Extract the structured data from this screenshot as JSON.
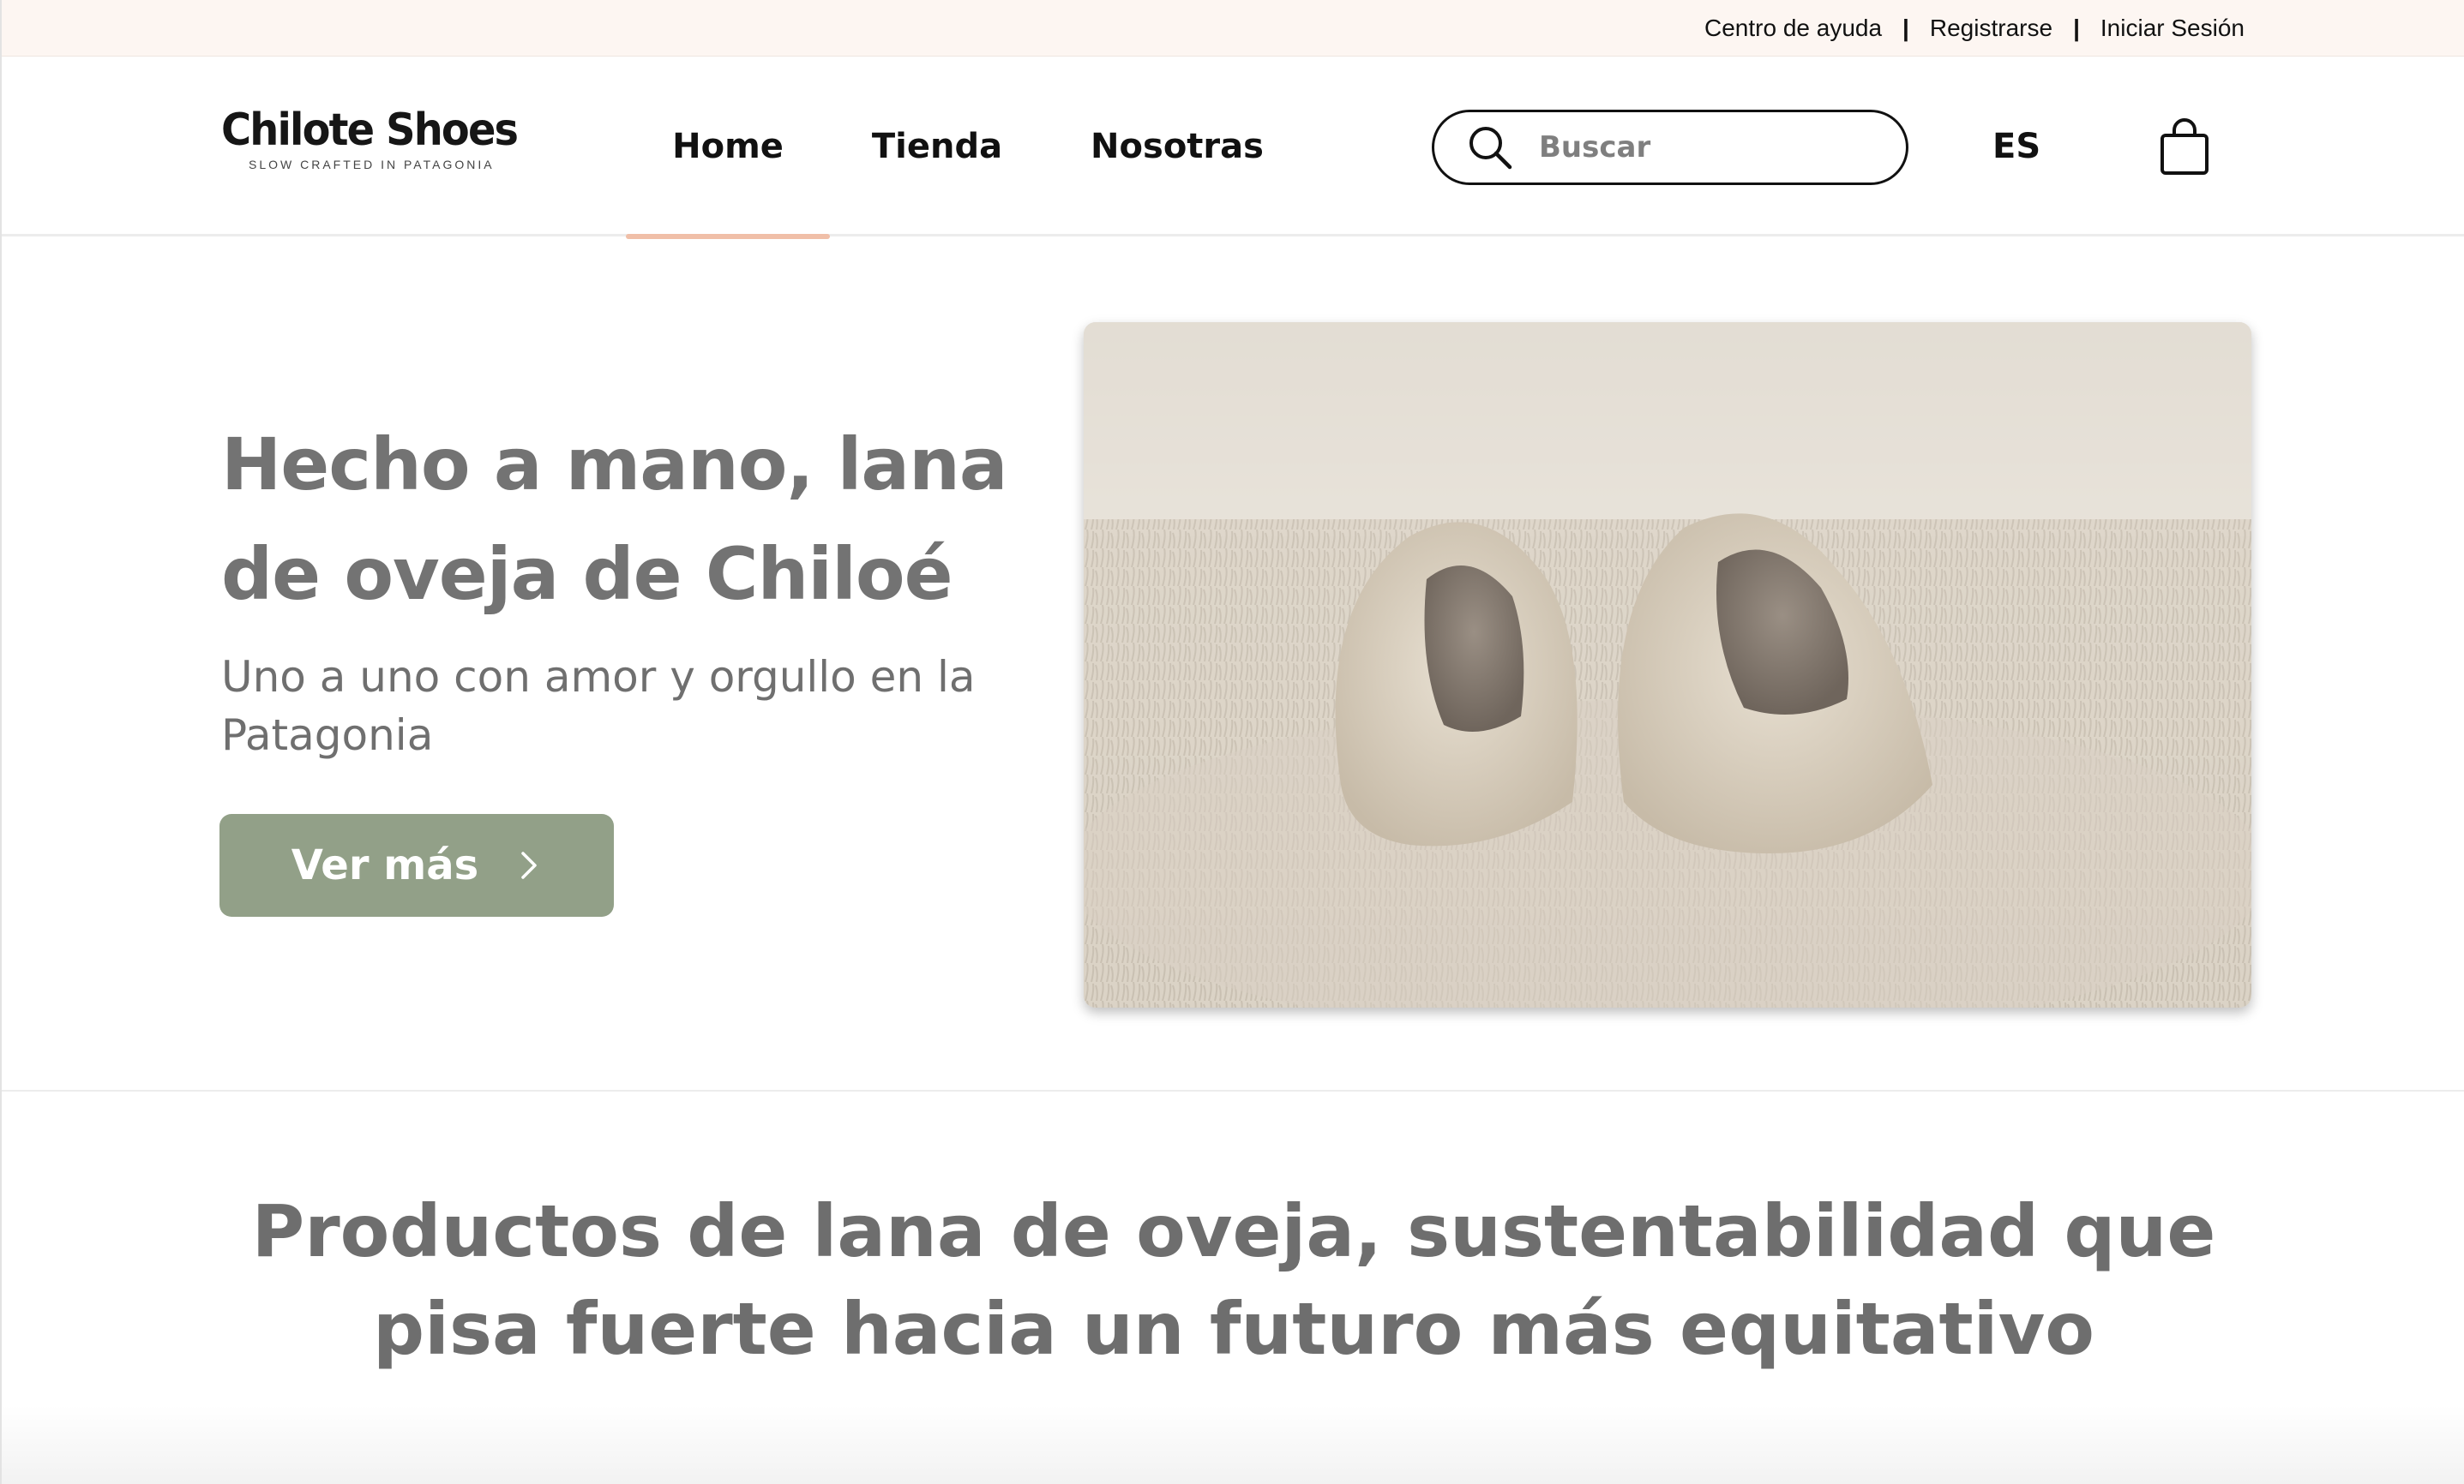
{
  "topbar": {
    "links": [
      "Centro de ayuda",
      "Registrarse",
      "Iniciar Sesión"
    ],
    "separator": "|"
  },
  "header": {
    "logo_title": "Chilote Shoes",
    "logo_tagline": "SLOW CRAFTED IN PATAGONIA",
    "nav": [
      "Home",
      "Tienda",
      "Nosotras"
    ],
    "active_nav": "Home",
    "search_placeholder": "Buscar",
    "language": "ES",
    "icons": {
      "search": "search-icon",
      "cart": "shopping-bag-icon"
    }
  },
  "hero": {
    "title": "Hecho a mano, lana de oveja de Chiloé",
    "subtitle": "Uno a uno con amor y orgullo en la Patagonia",
    "button_label": "Ver más",
    "button_color": "#92a088",
    "image_icon": "wool-slippers-photo"
  },
  "tagline": "Productos de lana de oveja, sustentabilidad que pisa fuerte hacia un futuro más equitativo",
  "colors": {
    "topbar_bg": "#fdf6f2",
    "nav_underline": "#f0bfa8",
    "heading_gray": "#737373"
  }
}
